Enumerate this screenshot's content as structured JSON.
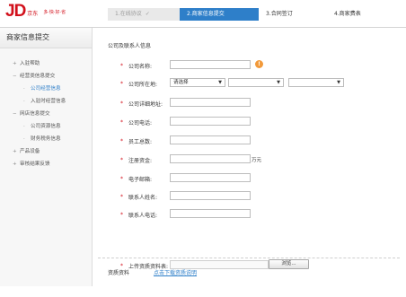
{
  "header": {
    "logo_text": "JD",
    "logo_sub": "京东",
    "logo_slogan": "多·快·好·省",
    "steps": [
      {
        "label": "1.在线协议",
        "check": "✓"
      },
      {
        "label": "2.商家信息提交"
      },
      {
        "label": "3.合同签订"
      },
      {
        "label": "4.商家费表"
      }
    ]
  },
  "sidebar": {
    "title": "商家信息提交",
    "items": [
      {
        "label": "入驻帮助",
        "marker": "+"
      },
      {
        "label": "经营类信息提交",
        "marker": "−"
      },
      {
        "label": "公司经营信息"
      },
      {
        "label": "入驻时经营信息"
      },
      {
        "label": "网店信息提交",
        "marker": "−"
      },
      {
        "label": "公司资源信息"
      },
      {
        "label": "财务税务信息"
      },
      {
        "label": "产品设备",
        "marker": "+"
      },
      {
        "label": "审核结果反馈",
        "marker": "+"
      }
    ]
  },
  "main": {
    "section_title": "公司及联系人信息",
    "fields": [
      {
        "label": "公司名称:",
        "required": "*"
      },
      {
        "label": "公司所在地:",
        "required": "*",
        "select_placeholder": "请选择"
      },
      {
        "label": "公司详细地址:",
        "required": "*"
      },
      {
        "label": "公司电话:",
        "required": "*"
      },
      {
        "label": "员工总数:",
        "required": "*"
      },
      {
        "label": "注册资金:",
        "required": "*",
        "unit": "万元"
      },
      {
        "label": "电子邮箱:",
        "required": "*"
      },
      {
        "label": "联系人姓名:",
        "required": "*"
      },
      {
        "label": "联系人电话:",
        "required": "*"
      }
    ],
    "warn_icon": "!",
    "upload": {
      "section_title": "资质资料",
      "link_text": "点击下载资质说明",
      "label": "上传资质资料表:",
      "required": "*",
      "browse_label": "浏览..."
    }
  }
}
